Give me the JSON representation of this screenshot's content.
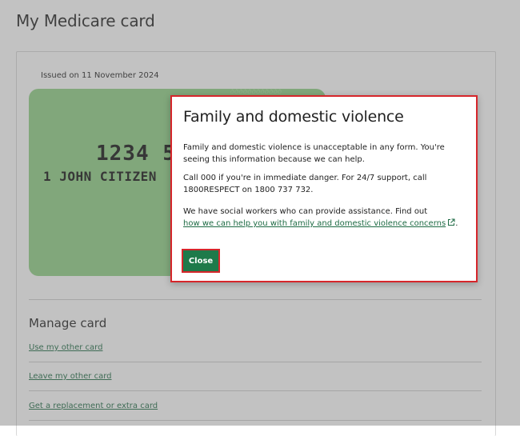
{
  "page": {
    "title": "My Medicare card"
  },
  "card": {
    "issued": "Issued on 11 November 2024",
    "number_visible": "1234 56",
    "name_line": "1 JOHN CITIZEN",
    "color": "#8fd085"
  },
  "manage": {
    "heading": "Manage card",
    "links": [
      "Use my other card",
      "Leave my other card",
      "Get a replacement or extra card"
    ]
  },
  "modal": {
    "title": "Family and domestic violence",
    "paragraph1": "Family and domestic violence is unacceptable in any form. You're seeing this information because we can help.",
    "paragraph2": "Call 000 if you're in immediate danger. For 24/7 support, call 1800RESPECT on 1800 737 732.",
    "paragraph3_text": "We have social workers who can provide assistance. Find out",
    "paragraph3_link": "how we can help you with family and domestic violence concerns",
    "paragraph3_end": ".",
    "link_icon": "external-link-icon",
    "close_label": "Close"
  },
  "colors": {
    "accent_green": "#1e7a4a",
    "link_green": "#1e6b44",
    "highlight_red": "#d6262b"
  }
}
